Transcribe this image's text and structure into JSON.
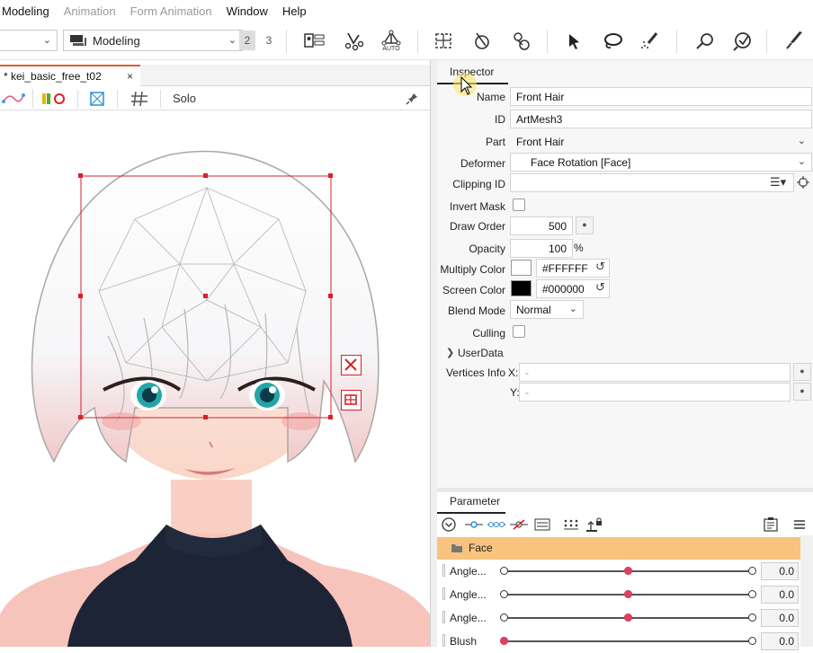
{
  "menu": {
    "items": [
      "Modeling",
      "Animation",
      "Form Animation",
      "Window",
      "Help"
    ],
    "disabled": [
      false,
      true,
      true,
      false,
      false
    ]
  },
  "toolbar": {
    "mode_value": "Modeling",
    "workspace_tabs": [
      "2",
      "3"
    ],
    "auto_label": "AUTO",
    "icons": [
      "view-layout-icon",
      "deform-brush-icon",
      "auto-mesh-icon",
      "mesh-edit-icon",
      "glue-icon",
      "pin-icon",
      "arrow-select-icon",
      "lasso-icon",
      "brush-select-icon",
      "rotate-tool-icon",
      "view-tool-icon",
      "pen-tool-icon"
    ]
  },
  "document": {
    "tab_title": "* kei_basic_free_t02",
    "close_glyph": "×"
  },
  "viewport_toolbar": {
    "solo_label": "Solo"
  },
  "inspector": {
    "tab": "Inspector",
    "name_label": "Name",
    "name_value": "Front Hair",
    "id_label": "ID",
    "id_value": "ArtMesh3",
    "part_label": "Part",
    "part_value": "Front Hair",
    "deformer_label": "Deformer",
    "deformer_value": "Face Rotation  [Face]",
    "clipping_label": "Clipping ID",
    "clipping_value": "",
    "invert_mask_label": "Invert Mask",
    "draw_order_label": "Draw Order",
    "draw_order_value": "500",
    "opacity_label": "Opacity",
    "opacity_value": "100",
    "opacity_unit": "%",
    "multiply_label": "Multiply Color",
    "multiply_value": "#FFFFFF",
    "screen_label": "Screen Color",
    "screen_value": "#000000",
    "blend_label": "Blend Mode",
    "blend_value": "Normal",
    "culling_label": "Culling",
    "userdata_label": "UserData",
    "vertices_label": "Vertices Info",
    "x_label": "X:",
    "x_value": "-",
    "y_label": "Y:",
    "y_value": "-",
    "colors": {
      "multiply": "#FFFFFF",
      "screen": "#000000"
    }
  },
  "parameter": {
    "tab": "Parameter",
    "group": "Face",
    "group_color": "#F7C37E",
    "rows": [
      {
        "name": "Angle...",
        "value": "0.0",
        "pos": 0.5,
        "has_mid": true
      },
      {
        "name": "Angle...",
        "value": "0.0",
        "pos": 0.5,
        "has_mid": true
      },
      {
        "name": "Angle...",
        "value": "0.0",
        "pos": 0.5,
        "has_mid": true
      },
      {
        "name": "Blush",
        "value": "0.0",
        "pos": 0.0,
        "has_mid": false
      }
    ]
  },
  "accent_colors": {
    "selection": "#D9202A",
    "param_key": "#E04060",
    "tab_active": "#E65A2E"
  }
}
